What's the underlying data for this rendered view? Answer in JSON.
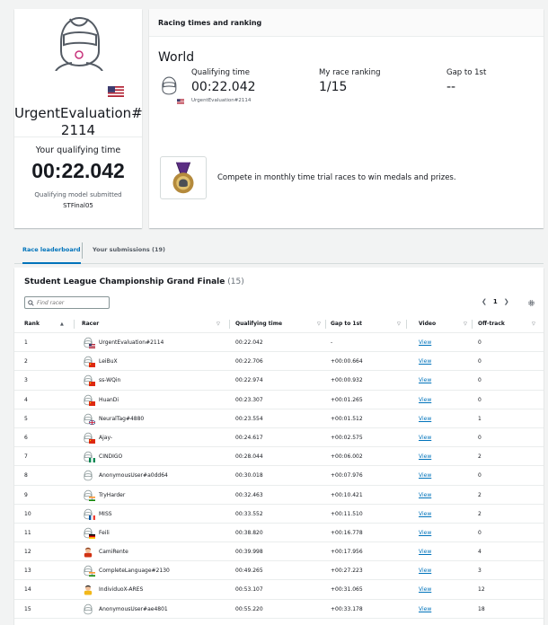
{
  "profile": {
    "name": "UrgentEvaluation#\n2114",
    "qual_label": "Your qualifying time",
    "qual_time": "00:22.042",
    "model_label": "Qualifying model submitted",
    "model_name": "STFinal05"
  },
  "racing": {
    "header": "Racing times and ranking",
    "world": "World",
    "qual_label": "Qualifying time",
    "qual_value": "00:22.042",
    "racer_name": "UrgentEvaluation#2114",
    "rank_label": "My race ranking",
    "rank_value": "1/15",
    "gap_label": "Gap to 1st",
    "gap_value": "--",
    "promo": "Compete in monthly time trial races to win medals and prizes."
  },
  "tabs": [
    {
      "label": "Race leaderboard",
      "active": true
    },
    {
      "label": "Your submissions (19)",
      "active": false
    }
  ],
  "leaderboard": {
    "title": "Student League Championship Grand Finale",
    "count": "(15)",
    "search_placeholder": "Find racer",
    "page": "1",
    "columns": [
      "Rank",
      "Racer",
      "Qualifying time",
      "Gap to 1st",
      "Video",
      "Off-track"
    ],
    "rows": [
      {
        "rank": "1",
        "racer": "UrgentEvaluation#2114",
        "time": "00:22.042",
        "gap": "-",
        "video": "View",
        "offtrack": "0",
        "flag": "us",
        "avatar": "helmet"
      },
      {
        "rank": "2",
        "racer": "LeiBuX",
        "time": "00:22.706",
        "gap": "+00:00.664",
        "video": "View",
        "offtrack": "0",
        "flag": "cn",
        "avatar": "helmet"
      },
      {
        "rank": "3",
        "racer": "ss-WQin",
        "time": "00:22.974",
        "gap": "+00:00.932",
        "video": "View",
        "offtrack": "0",
        "flag": "cn",
        "avatar": "helmet"
      },
      {
        "rank": "4",
        "racer": "HuanDi",
        "time": "00:23.307",
        "gap": "+00:01.265",
        "video": "View",
        "offtrack": "0",
        "flag": "cn",
        "avatar": "helmet"
      },
      {
        "rank": "5",
        "racer": "NeuralTag#4880",
        "time": "00:23.554",
        "gap": "+00:01.512",
        "video": "View",
        "offtrack": "1",
        "flag": "gb",
        "avatar": "helmet"
      },
      {
        "rank": "6",
        "racer": "Ajay-",
        "time": "00:24.617",
        "gap": "+00:02.575",
        "video": "View",
        "offtrack": "0",
        "flag": "cn",
        "avatar": "helmet"
      },
      {
        "rank": "7",
        "racer": "CINDIGO",
        "time": "00:28.044",
        "gap": "+00:06.002",
        "video": "View",
        "offtrack": "2",
        "flag": "ng",
        "avatar": "helmet"
      },
      {
        "rank": "8",
        "racer": "AnonymousUser#a0dd64",
        "time": "00:30.018",
        "gap": "+00:07.976",
        "video": "View",
        "offtrack": "0",
        "flag": "none",
        "avatar": "helmet"
      },
      {
        "rank": "9",
        "racer": "TryHarder",
        "time": "00:32.463",
        "gap": "+00:10.421",
        "video": "View",
        "offtrack": "2",
        "flag": "in",
        "avatar": "helmet"
      },
      {
        "rank": "10",
        "racer": "MISS",
        "time": "00:33.552",
        "gap": "+00:11.510",
        "video": "View",
        "offtrack": "2",
        "flag": "fr",
        "avatar": "helmet"
      },
      {
        "rank": "11",
        "racer": "Feili",
        "time": "00:38.820",
        "gap": "+00:16.778",
        "video": "View",
        "offtrack": "0",
        "flag": "de",
        "avatar": "helmet"
      },
      {
        "rank": "12",
        "racer": "CamiRente",
        "time": "00:39.998",
        "gap": "+00:17.956",
        "video": "View",
        "offtrack": "4",
        "flag": "none",
        "avatar": "person-red"
      },
      {
        "rank": "13",
        "racer": "CompleteLanguage#2130",
        "time": "00:49.265",
        "gap": "+00:27.223",
        "video": "View",
        "offtrack": "3",
        "flag": "in",
        "avatar": "helmet"
      },
      {
        "rank": "14",
        "racer": "IndividuoX-ARES",
        "time": "00:53.107",
        "gap": "+00:31.065",
        "video": "View",
        "offtrack": "12",
        "flag": "none",
        "avatar": "person-yellow"
      },
      {
        "rank": "15",
        "racer": "AnonymousUser#ae4801",
        "time": "00:55.220",
        "gap": "+00:33.178",
        "video": "View",
        "offtrack": "18",
        "flag": "none",
        "avatar": "helmet"
      }
    ]
  }
}
